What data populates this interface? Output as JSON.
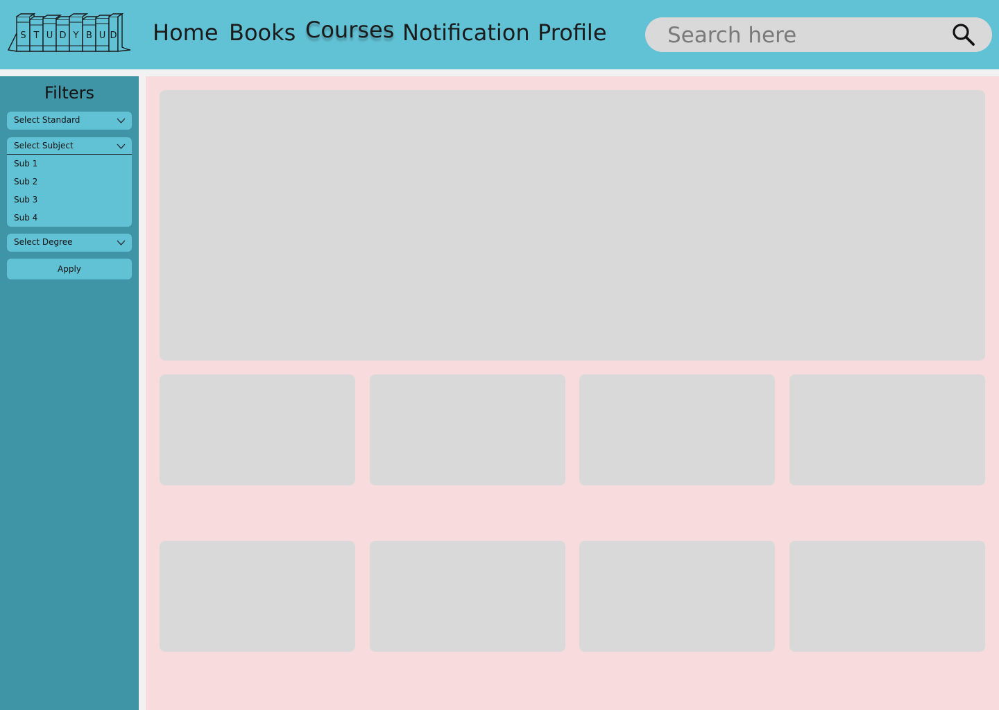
{
  "brand": {
    "logo_letters": [
      "S",
      "T",
      "U",
      "D",
      "Y",
      "B",
      "U",
      "D"
    ]
  },
  "nav": {
    "items": [
      {
        "label": "Home"
      },
      {
        "label": "Books"
      },
      {
        "label": "Courses",
        "active": true
      },
      {
        "label": "Notification"
      },
      {
        "label": "Profile"
      }
    ]
  },
  "search": {
    "placeholder": "Search here",
    "value": ""
  },
  "sidebar": {
    "title": "Filters",
    "standard_select": "Select Standard",
    "subject_select": "Select Subject",
    "subject_options": [
      "Sub 1",
      "Sub 2",
      "Sub 3",
      "Sub 4"
    ],
    "degree_select": "Select Degree",
    "apply_label": "Apply"
  },
  "icons": {
    "search": "search-icon",
    "chevron": "chevron-down-icon"
  },
  "colors": {
    "header": "#62c2d5",
    "sidebar": "#3f95a6",
    "main_bg": "#f8dcdd",
    "card": "#d9d9d9"
  }
}
